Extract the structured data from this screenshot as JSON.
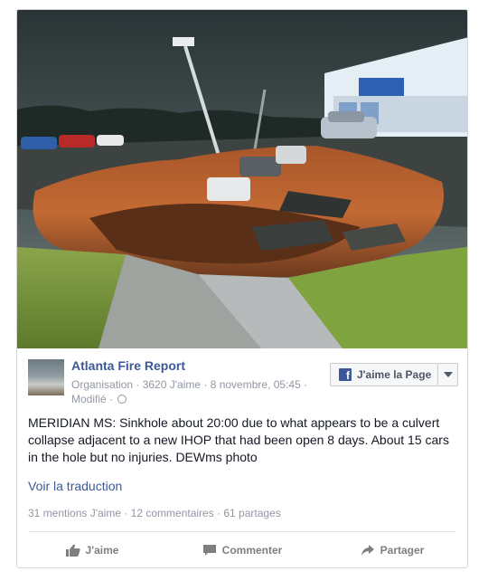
{
  "post": {
    "page_name": "Atlanta Fire Report",
    "meta_line": "Organisation · 3620 J'aime · 8 novembre, 05:45 ·",
    "modified": "Modifié ·",
    "like_page_label": "J'aime la Page",
    "text": "MERIDIAN MS: Sinkhole about 20:00 due to what appears to be a culvert collapse adjacent to a new IHOP that had been open 8 days. About 15 cars in the hole but no injuries. DEWms photo",
    "translate_link": "Voir la traduction",
    "stats": "31 mentions J'aime · 12 commentaires · 61 partages"
  },
  "actions": {
    "like": "J'aime",
    "comment": "Commenter",
    "share": "Partager"
  },
  "icons": {
    "like": "thumbs-up-icon",
    "comment": "comment-bubble-icon",
    "share": "share-arrow-icon",
    "facebook": "facebook-f-icon",
    "privacy": "globe-icon"
  },
  "colors": {
    "link_blue": "#3b5998",
    "meta_gray": "#9197a3",
    "action_gray": "#7f7f7f"
  }
}
